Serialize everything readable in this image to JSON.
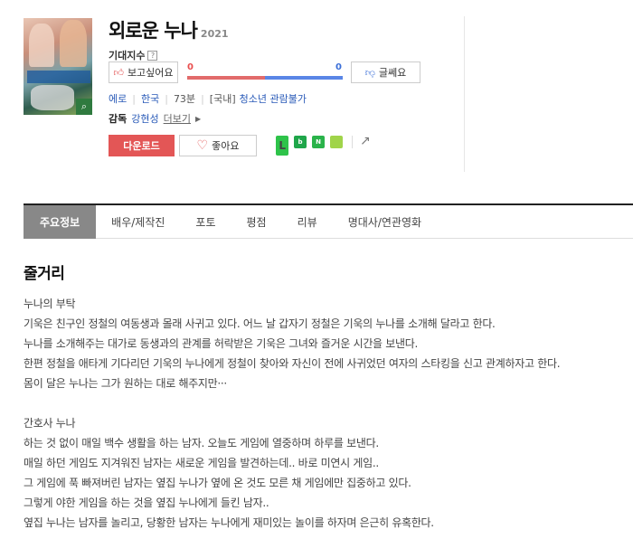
{
  "movie": {
    "title": "외로운 누나",
    "year": "2021"
  },
  "expect": {
    "label": "기대지수",
    "help": "?",
    "want_label": "보고싶어요",
    "no_label": "글쎄요",
    "want_count": "0",
    "no_count": "0",
    "want_ratio": 0.5
  },
  "meta": {
    "genre": "에로",
    "country": "한국",
    "runtime": "73분",
    "rating_prefix": "[국내]",
    "rating": "청소년 관람불가"
  },
  "director": {
    "label": "감독",
    "name": "강현성",
    "more": "더보기"
  },
  "actions": {
    "download": "다운로드",
    "like": "좋아요"
  },
  "share": {
    "icons": [
      "line-icon",
      "band-icon",
      "book-icon",
      "memo-icon",
      "share-icon"
    ]
  },
  "tabs": [
    "주요정보",
    "배우/제작진",
    "포토",
    "평점",
    "리뷰",
    "명대사/연관영화"
  ],
  "synopsis": {
    "heading": "줄거리",
    "story1_title": "누나의 부탁",
    "story1_lines": [
      "기욱은 친구인 정철의 여동생과 몰래 사귀고 있다. 어느 날 갑자기 정철은 기욱의 누나를 소개해 달라고 한다.",
      "누나를 소개해주는 대가로 동생과의 관계를 허락받은 기욱은 그녀와 즐거운 시간을 보낸다.",
      "한편 정철을 애타게 기다리던 기욱의 누나에게 정철이 찾아와 자신이 전에 사귀었던 여자의 스타킹을 신고 관계하자고 한다.",
      "몸이 달은 누나는 그가 원하는 대로 해주지만···"
    ],
    "story2_title": "간호사 누나",
    "story2_lines": [
      "하는 것 없이 매일 백수 생활을 하는 남자. 오늘도 게임에 열중하며 하루를 보낸다.",
      "매일 하던 게임도 지겨워진 남자는 새로운 게임을 발견하는데.. 바로 미연시 게임..",
      "그 게임에 푹 빠져버린 남자는 옆집 누나가 옆에 온 것도 모른 채 게임에만 집중하고 있다.",
      "그렇게 야한 게임을 하는 것을 옆집 누나에게 들킨 남자..",
      "옆집 누나는 남자를 놀리고, 당황한 남자는 누나에게 재미있는 놀이를 하자며 은근히 유혹한다."
    ]
  },
  "colors": {
    "accent_red": "#e35656",
    "gauge_blue": "#5a86e6",
    "link_blue": "#2a5bb8",
    "active_tab": "#888888"
  }
}
